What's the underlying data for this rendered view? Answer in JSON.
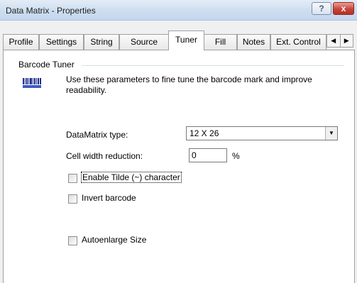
{
  "window": {
    "title": "Data Matrix - Properties",
    "help_label": "?",
    "close_label": "x"
  },
  "tabs": [
    {
      "label": "Profile"
    },
    {
      "label": "Settings"
    },
    {
      "label": "String"
    },
    {
      "label": "Source"
    },
    {
      "label": "Tuner",
      "active": true
    },
    {
      "label": "Fill"
    },
    {
      "label": "Notes"
    },
    {
      "label": "Ext. Control"
    }
  ],
  "tab_scroll": {
    "left_label": "◀",
    "right_label": "▶"
  },
  "tuner": {
    "group_title": "Barcode Tuner",
    "description": "Use these parameters to fine tune the barcode mark and improve readability.",
    "datamatrix_type_label": "DataMatrix type:",
    "datamatrix_type_value": "12 X 26",
    "cell_width_label": "Cell width reduction:",
    "cell_width_value": "0",
    "cell_width_unit": "%",
    "enable_tilde_label": "Enable Tilde (~) character",
    "enable_tilde_checked": false,
    "invert_label": "Invert barcode",
    "invert_checked": false,
    "autoenlarge_label": "Autoenlarge Size",
    "autoenlarge_checked": false
  },
  "icons": {
    "barcode": "barcode-icon",
    "dropdown": "chevron-down-icon"
  }
}
